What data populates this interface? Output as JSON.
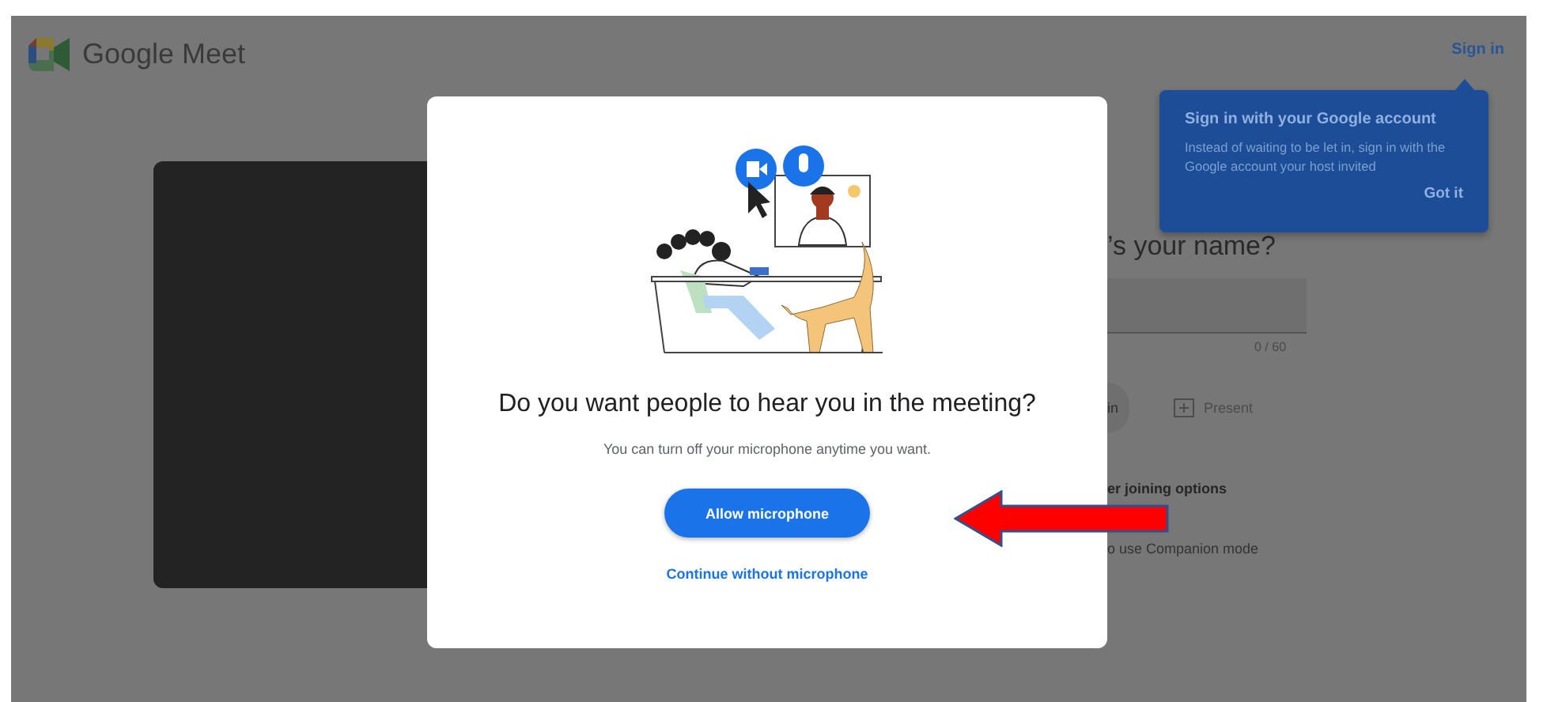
{
  "header": {
    "title": "Google Meet",
    "sign_in": "Sign in"
  },
  "tooltip": {
    "title": "Sign in with your Google account",
    "body": "Instead of waiting to be let in, sign in with the Google account your host invited",
    "action": "Got it"
  },
  "name_form": {
    "title": "’s your name?",
    "counter": "0 / 60",
    "join_button": "in",
    "present_button": "Present",
    "other_options": "er joining options",
    "companion": "o use Companion mode"
  },
  "dialog": {
    "heading": "Do you want people to hear you in the meeting?",
    "body": "You can turn off your microphone anytime you want.",
    "primary_button": "Allow microphone",
    "secondary_link": "Continue without microphone"
  }
}
